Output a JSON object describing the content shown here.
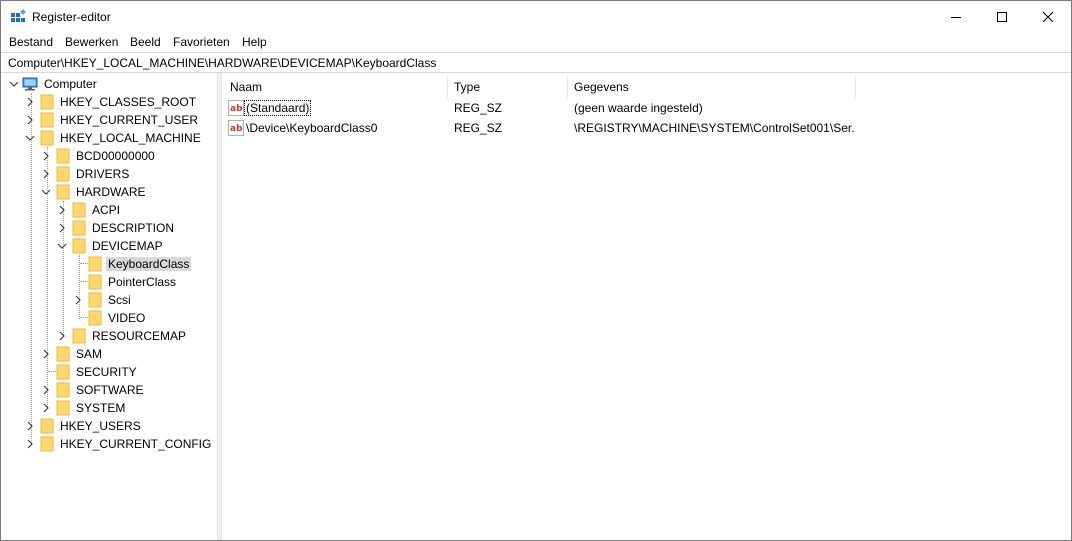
{
  "window": {
    "title": "Register-editor"
  },
  "menu": [
    "Bestand",
    "Bewerken",
    "Beeld",
    "Favorieten",
    "Help"
  ],
  "address": "Computer\\HKEY_LOCAL_MACHINE\\HARDWARE\\DEVICEMAP\\KeyboardClass",
  "tree": {
    "root": "Computer",
    "items": [
      "HKEY_CLASSES_ROOT",
      "HKEY_CURRENT_USER",
      "HKEY_LOCAL_MACHINE",
      "BCD00000000",
      "DRIVERS",
      "HARDWARE",
      "ACPI",
      "DESCRIPTION",
      "DEVICEMAP",
      "KeyboardClass",
      "PointerClass",
      "Scsi",
      "VIDEO",
      "RESOURCEMAP",
      "SAM",
      "SECURITY",
      "SOFTWARE",
      "SYSTEM",
      "HKEY_USERS",
      "HKEY_CURRENT_CONFIG"
    ]
  },
  "list": {
    "columns": [
      "Naam",
      "Type",
      "Gegevens"
    ],
    "rows": [
      {
        "name": "(Standaard)",
        "type": "REG_SZ",
        "data": "(geen waarde ingesteld)"
      },
      {
        "name": "\\Device\\KeyboardClass0",
        "type": "REG_SZ",
        "data": "\\REGISTRY\\MACHINE\\SYSTEM\\ControlSet001\\Ser..."
      }
    ]
  },
  "colors": {
    "folder": "#ffd86b",
    "folder_dark": "#e8b84a",
    "selection": "#d9d9d9",
    "accent": "#0078d7"
  }
}
